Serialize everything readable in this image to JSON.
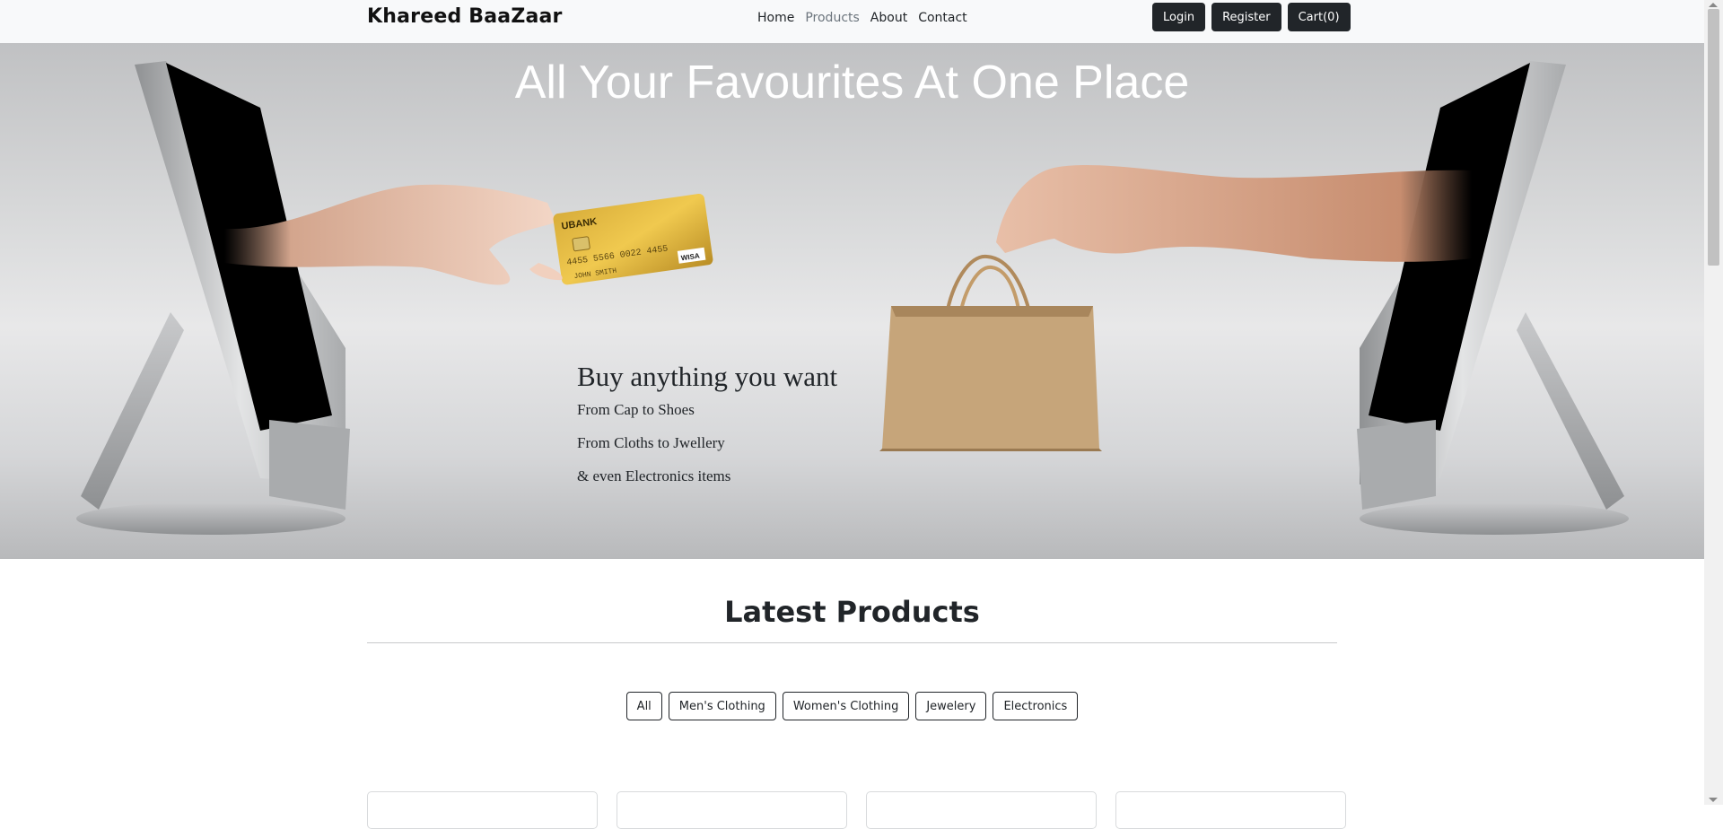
{
  "navbar": {
    "brand": "Khareed BaaZaar",
    "links": [
      {
        "label": "Home",
        "active": false
      },
      {
        "label": "Products",
        "active": true
      },
      {
        "label": "About",
        "active": false
      },
      {
        "label": "Contact",
        "active": false
      }
    ],
    "buttons": {
      "login": "Login",
      "register": "Register",
      "cart": "Cart(0)"
    }
  },
  "hero": {
    "title": "All Your Favourites At One Place",
    "subtitle": "Buy anything you want",
    "lines": [
      "From Cap to Shoes",
      "From Cloths to Jwellery",
      "& even Electronics items"
    ],
    "card_text": {
      "bank": "UBANK",
      "number": "4455 5566 0022 4455",
      "holder": "JOHN SMITH",
      "brand": "WISA"
    }
  },
  "products": {
    "title": "Latest Products",
    "filters": [
      "All",
      "Men's Clothing",
      "Women's Clothing",
      "Jewelery",
      "Electronics"
    ]
  },
  "colors": {
    "dark": "#212529",
    "navbar_bg": "#f8f9fa",
    "hero_bg": "#d9dadb"
  }
}
